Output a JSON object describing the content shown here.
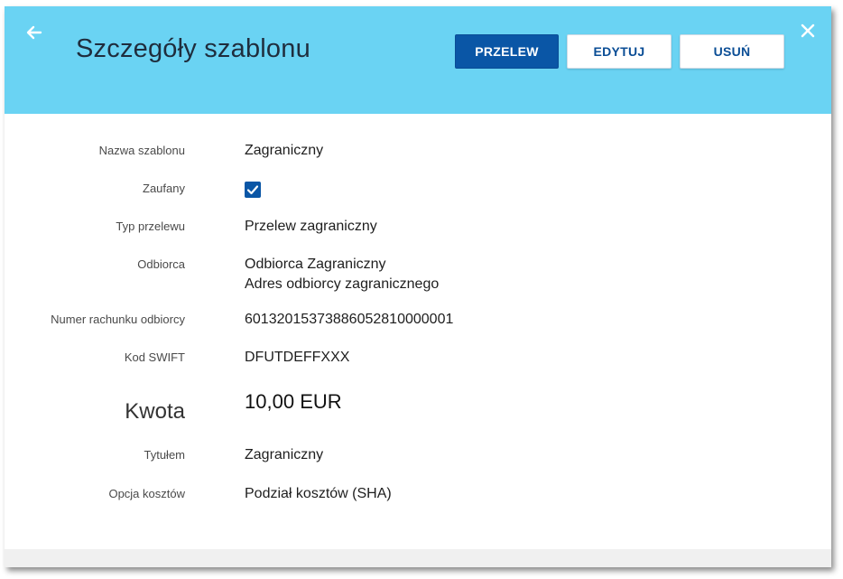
{
  "header": {
    "title": "Szczegóły szablonu",
    "buttons": {
      "transfer": "PRZELEW",
      "edit": "EDYTUJ",
      "delete": "USUŃ"
    }
  },
  "details": {
    "template_name": {
      "label": "Nazwa szablonu",
      "value": "Zagraniczny"
    },
    "trusted": {
      "label": "Zaufany",
      "checked": true
    },
    "transfer_type": {
      "label": "Typ przelewu",
      "value": "Przelew zagraniczny"
    },
    "recipient": {
      "label": "Odbiorca",
      "name": "Odbiorca Zagraniczny",
      "address": "Adres odbiorcy zagranicznego"
    },
    "account_number": {
      "label": "Numer rachunku odbiorcy",
      "value": "60132015373886052810000001"
    },
    "swift": {
      "label": "Kod SWIFT",
      "value": "DFUTDEFFXXX"
    },
    "amount": {
      "label": "Kwota",
      "value": "10,00",
      "currency": "EUR"
    },
    "title_field": {
      "label": "Tytułem",
      "value": "Zagraniczny"
    },
    "cost_option": {
      "label": "Opcja kosztów",
      "value": "Podział kosztów (SHA)"
    }
  },
  "colors": {
    "header_bg": "#6ad3f3",
    "primary": "#0a56a6"
  },
  "icons": {
    "back": "arrow-left-icon",
    "close": "close-icon",
    "checkbox": "checkmark-icon"
  }
}
